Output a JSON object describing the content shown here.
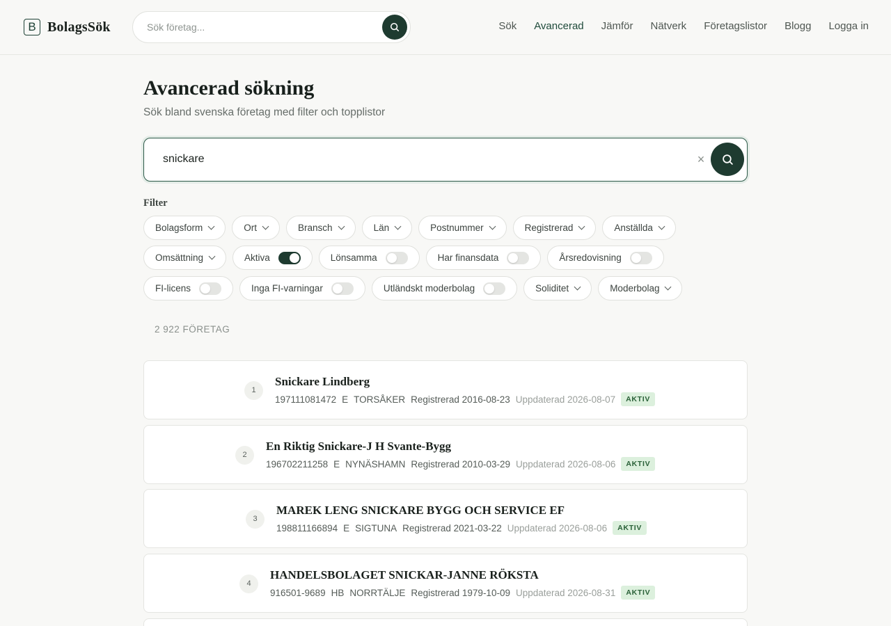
{
  "header": {
    "logo_letter": "B",
    "logo_text": "BolagsSök",
    "search_placeholder": "Sök företag...",
    "nav": [
      "Sök",
      "Avancerad",
      "Jämför",
      "Nätverk",
      "Företagslistor",
      "Blogg",
      "Logga in"
    ],
    "active_nav": "Avancerad"
  },
  "page": {
    "title": "Avancerad sökning",
    "subtitle": "Sök bland svenska företag med filter och topplistor",
    "search_value": "snickare",
    "clear_symbol": "×"
  },
  "filters": {
    "label": "Filter",
    "row1": [
      {
        "label": "Bolagsform",
        "type": "dropdown"
      },
      {
        "label": "Ort",
        "type": "dropdown"
      },
      {
        "label": "Bransch",
        "type": "dropdown"
      },
      {
        "label": "Län",
        "type": "dropdown"
      },
      {
        "label": "Postnummer",
        "type": "dropdown"
      },
      {
        "label": "Registrerad",
        "type": "dropdown"
      },
      {
        "label": "Anställda",
        "type": "dropdown"
      }
    ],
    "row2": [
      {
        "label": "Omsättning",
        "type": "dropdown"
      },
      {
        "label": "Aktiva",
        "type": "toggle",
        "on": true
      },
      {
        "label": "Lönsamma",
        "type": "toggle",
        "on": false
      },
      {
        "label": "Har finansdata",
        "type": "toggle",
        "on": false
      },
      {
        "label": "Årsredovisning",
        "type": "toggle",
        "on": false
      }
    ],
    "row3": [
      {
        "label": "FI-licens",
        "type": "toggle",
        "on": false
      },
      {
        "label": "Inga FI-varningar",
        "type": "toggle",
        "on": false
      },
      {
        "label": "Utländskt moderbolag",
        "type": "toggle",
        "on": false
      },
      {
        "label": "Soliditet",
        "type": "dropdown"
      },
      {
        "label": "Moderbolag",
        "type": "dropdown"
      }
    ]
  },
  "results": {
    "count_text": "2 922 FÖRETAG",
    "items": [
      {
        "rank": "1",
        "name": "Snickare Lindberg",
        "orgnr": "197111081472",
        "form": "E",
        "city": "TORSÅKER",
        "registered": "Registrerad 2016-08-23",
        "updated": "Uppdaterad 2026-08-07",
        "status": "AKTIV"
      },
      {
        "rank": "2",
        "name": "En Riktig Snickare-J H Svante-Bygg",
        "orgnr": "196702211258",
        "form": "E",
        "city": "NYNÄSHAMN",
        "registered": "Registrerad 2010-03-29",
        "updated": "Uppdaterad 2026-08-06",
        "status": "AKTIV"
      },
      {
        "rank": "3",
        "name": "MAREK LENG SNICKARE BYGG OCH SERVICE EF",
        "orgnr": "198811166894",
        "form": "E",
        "city": "SIGTUNA",
        "registered": "Registrerad 2021-03-22",
        "updated": "Uppdaterad 2026-08-06",
        "status": "AKTIV"
      },
      {
        "rank": "4",
        "name": "HANDELSBOLAGET SNICKAR-JANNE RÖKSTA",
        "orgnr": "916501-9689",
        "form": "HB",
        "city": "NORRTÄLJE",
        "registered": "Registrerad 1979-10-09",
        "updated": "Uppdaterad 2026-08-31",
        "status": "AKTIV"
      }
    ]
  },
  "colors": {
    "accent": "#1e3b30",
    "active_nav": "#1e4a3a",
    "badge_bg": "#dcf0dd",
    "badge_text": "#2a6138"
  }
}
